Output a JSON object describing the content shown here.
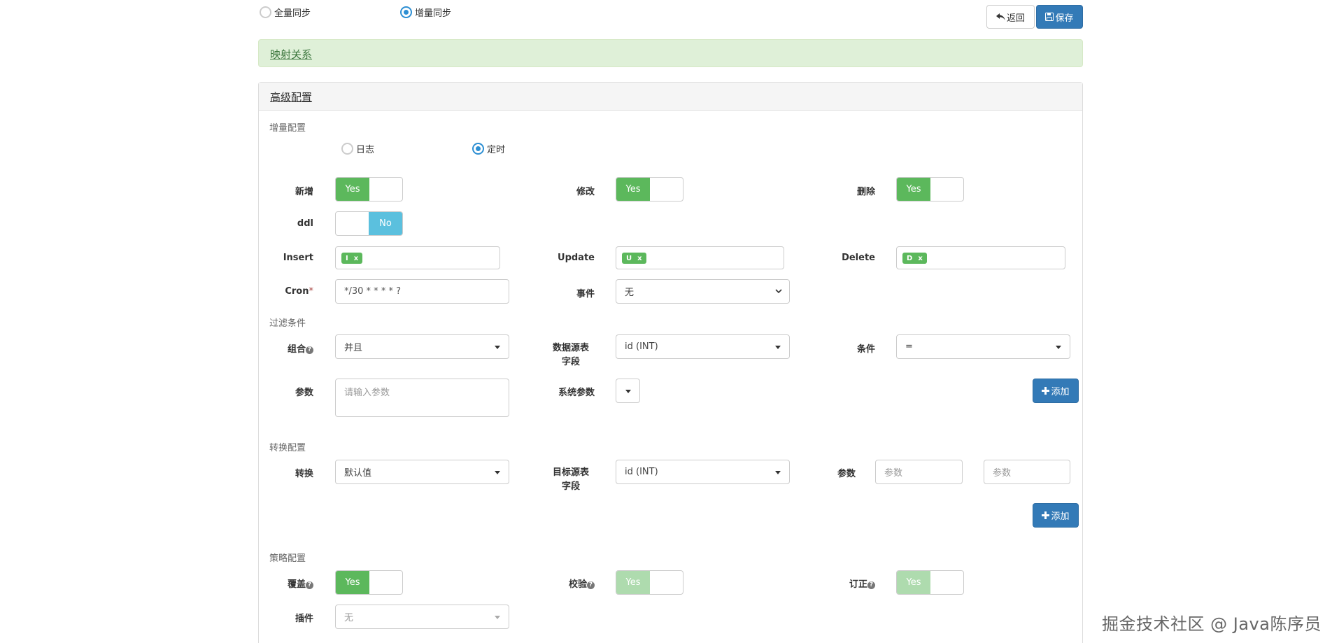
{
  "sync_mode": {
    "full_label": "全量同步",
    "incremental_label": "增量同步",
    "selected": "incremental"
  },
  "toolbar": {
    "back_label": "返回",
    "save_label": "保存"
  },
  "mapping_panel": {
    "title": "映射关系"
  },
  "advanced": {
    "title": "高级配置",
    "incremental_section": "增量配置",
    "incremental_mode": {
      "log_label": "日志",
      "timer_label": "定时",
      "selected": "timer"
    },
    "switches": {
      "add_label": "新增",
      "add_value": "Yes",
      "modify_label": "修改",
      "modify_value": "Yes",
      "delete_label": "删除",
      "delete_value": "Yes",
      "ddl_label": "ddl",
      "ddl_value": "No"
    },
    "events": {
      "insert_label": "Insert",
      "insert_tag": "I",
      "update_label": "Update",
      "update_tag": "U",
      "delete_label": "Delete",
      "delete_tag": "D",
      "tag_remove": "x"
    },
    "cron": {
      "label": "Cron",
      "required_mark": "*",
      "value": "*/30 * * * * ?"
    },
    "event_select": {
      "label": "事件",
      "value": "无"
    },
    "filter_section": "过滤条件",
    "filter": {
      "combine_label": "组合",
      "combine_value": "并且",
      "source_field_label_1": "数据源表",
      "source_field_label_2": "字段",
      "source_field_value": "id (INT)",
      "condition_label": "条件",
      "condition_value": "=",
      "param_label": "参数",
      "param_placeholder": "请输入参数",
      "sys_param_label": "系统参数",
      "add_label": "添加"
    },
    "convert_section": "转换配置",
    "convert": {
      "convert_label": "转换",
      "convert_value": "默认值",
      "target_field_label_1": "目标源表",
      "target_field_label_2": "字段",
      "target_field_value": "id (INT)",
      "param_label": "参数",
      "param_placeholder": "参数",
      "add_label": "添加"
    },
    "strategy_section": "策略配置",
    "strategy": {
      "override_label": "覆盖",
      "override_value": "Yes",
      "verify_label": "校验",
      "verify_value": "Yes",
      "correct_label": "订正",
      "correct_value": "Yes",
      "plugin_label": "插件",
      "plugin_value": "无"
    }
  },
  "watermark": "掘金技术社区 @ Java陈序员",
  "colors": {
    "primary": "#337ab7",
    "success": "#5cb85c",
    "info": "#5bc0de",
    "panel_success_bg": "#dff0d8",
    "radio_active": "#2d8fd3"
  }
}
